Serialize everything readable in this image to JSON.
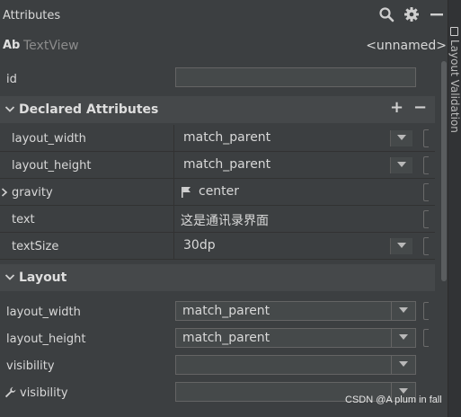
{
  "panel": {
    "title": "Attributes",
    "icons": [
      "search-icon",
      "gear-icon",
      "minimize-icon"
    ]
  },
  "widget": {
    "icon_text": "Ab",
    "type": "TextView",
    "id_display": "<unnamed>"
  },
  "id_field": {
    "label": "id",
    "value": ""
  },
  "declared": {
    "title": "Declared Attributes",
    "add": "+",
    "remove": "−",
    "rows": [
      {
        "label": "layout_width",
        "value": "match_parent"
      },
      {
        "label": "layout_height",
        "value": "match_parent"
      },
      {
        "label": "gravity",
        "value": "center"
      },
      {
        "label": "text",
        "value": "这是通讯录界面"
      },
      {
        "label": "textSize",
        "value": "30dp"
      }
    ]
  },
  "layout": {
    "title": "Layout",
    "rows": [
      {
        "label": "layout_width",
        "value": "match_parent"
      },
      {
        "label": "layout_height",
        "value": "match_parent"
      },
      {
        "label": "visibility",
        "value": ""
      },
      {
        "label": "visibility",
        "value": ""
      }
    ]
  },
  "side_panel": {
    "label": "Layout Validation"
  },
  "watermark": "CSDN @A plum in fall"
}
